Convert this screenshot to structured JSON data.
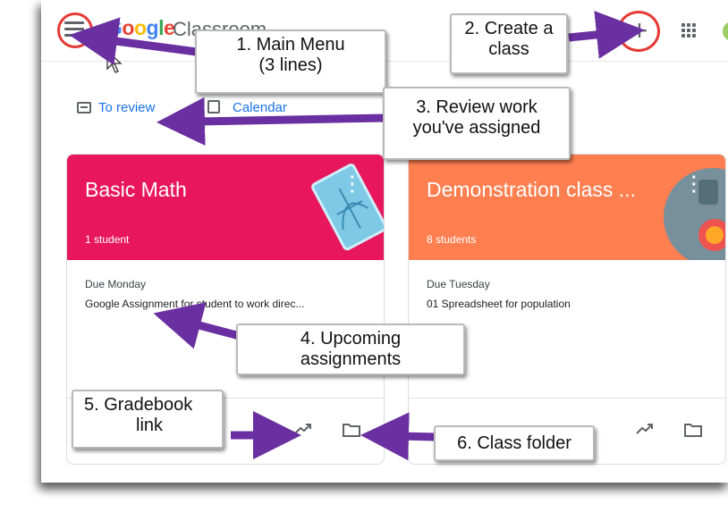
{
  "app": {
    "logo_text": "Google",
    "name": "Classroom"
  },
  "nav": {
    "menu_icon": "hamburger-menu-icon",
    "create_icon": "plus-icon",
    "create_symbol": "+",
    "apps_icon": "apps-grid-icon",
    "avatar_icon": "account-avatar"
  },
  "links": {
    "to_review": "To review",
    "calendar": "Calendar"
  },
  "classes": [
    {
      "title": "Basic Math",
      "students": "1 student",
      "due": "Due Monday",
      "assignment": "Google Assignment for student to work direc...",
      "header_color": "#e8175d"
    },
    {
      "title": "Demonstration class ...",
      "students": "8 students",
      "due": "Due Tuesday",
      "assignment": "01 Spreadsheet for population",
      "header_color": "#ff7f50"
    }
  ],
  "annotations": {
    "main_menu": [
      "1. Main Menu",
      "(3 lines)"
    ],
    "create_class": [
      "2. Create a",
      "class"
    ],
    "review_work": [
      "3. Review work",
      "you've assigned"
    ],
    "upcoming": [
      "4. Upcoming",
      "assignments"
    ],
    "gradebook": [
      "5. Gradebook",
      "link"
    ],
    "class_folder": "6. Class folder"
  },
  "colors": {
    "highlight_circle": "#e53935",
    "arrow": "#6a2fa0",
    "link_blue": "#1a73e8"
  }
}
